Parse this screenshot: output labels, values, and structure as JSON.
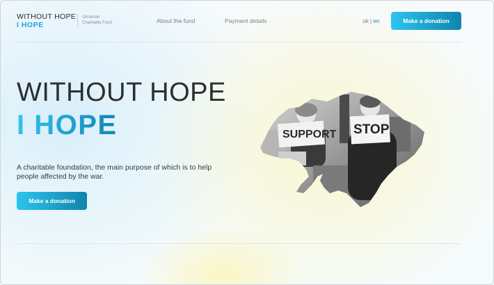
{
  "header": {
    "logo_line1": "WITHOUT HOPE",
    "logo_line2": "I HOPE",
    "tagline_line1": "Ukrainian",
    "tagline_line2": "Charitable Fund",
    "nav": [
      {
        "label": "About the fund"
      },
      {
        "label": "Payment details"
      }
    ],
    "lang": {
      "uk": "uk",
      "separator": "|",
      "en": "en",
      "selected": "en"
    },
    "donate_label": "Make a donation"
  },
  "hero": {
    "title_line1": "WITHOUT HOPE",
    "title_line2": "I HOPE",
    "description": "A charitable foundation, the main purpose of which is to help people affected by the war.",
    "donate_label": "Make a donation",
    "image": {
      "signs": [
        "SUPPORT",
        "STOP"
      ]
    }
  },
  "colors": {
    "accent": "#1ba6d6",
    "button_start": "#2ec4ee",
    "button_end": "#0f84ad"
  },
  "icons": {
    "map_image": "ukraine-map-photo"
  }
}
